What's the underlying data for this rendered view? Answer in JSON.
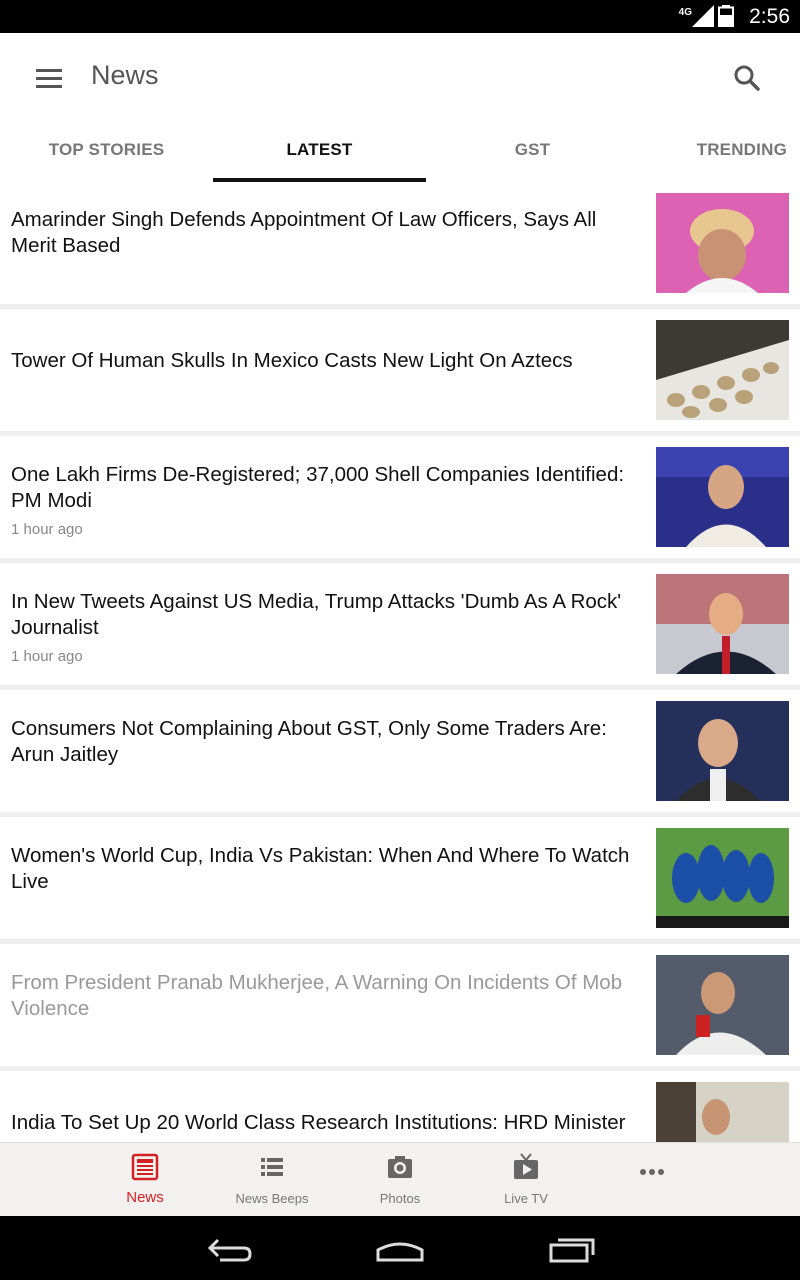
{
  "statusbar": {
    "network": "4G",
    "time": "2:56"
  },
  "appbar": {
    "title": "News"
  },
  "tabs": [
    {
      "label": "TOP STORIES",
      "active": false
    },
    {
      "label": "LATEST",
      "active": true
    },
    {
      "label": "GST",
      "active": false
    },
    {
      "label": "TRENDING",
      "active": false
    }
  ],
  "articles": [
    {
      "title": "Amarinder Singh Defends Appointment Of Law Officers, Says All Merit Based",
      "time": ""
    },
    {
      "title": "Tower Of Human Skulls In Mexico Casts New Light On Aztecs",
      "time": ""
    },
    {
      "title": "One Lakh Firms De-Registered; 37,000 Shell Companies Identified: PM Modi",
      "time": "1 hour ago"
    },
    {
      "title": "In New Tweets Against US Media, Trump Attacks 'Dumb As A Rock' Journalist",
      "time": "1 hour ago"
    },
    {
      "title": "Consumers Not Complaining About GST, Only Some Traders Are: Arun Jaitley",
      "time": ""
    },
    {
      "title": "Women's World Cup, India Vs Pakistan: When And Where To Watch Live",
      "time": ""
    },
    {
      "title": "From President Pranab Mukherjee, A Warning On Incidents Of Mob Violence",
      "time": "",
      "read": true
    },
    {
      "title": "India To Set Up 20 World Class Research Institutions: HRD Minister",
      "time": ""
    }
  ],
  "bottomnav": [
    {
      "label": "News",
      "icon": "newspaper-icon",
      "active": true
    },
    {
      "label": "News Beeps",
      "icon": "list-icon",
      "active": false
    },
    {
      "label": "Photos",
      "icon": "camera-icon",
      "active": false
    },
    {
      "label": "Live TV",
      "icon": "tv-icon",
      "active": false
    },
    {
      "label": "",
      "icon": "more-icon",
      "active": false
    }
  ],
  "colors": {
    "accent": "#d42020",
    "text": "#111111",
    "muted": "#888888"
  }
}
